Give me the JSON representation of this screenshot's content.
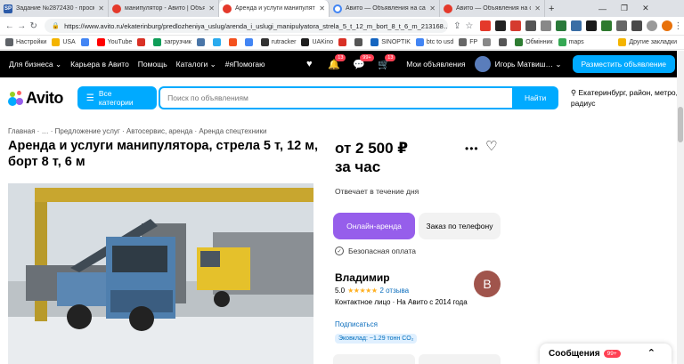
{
  "browser": {
    "tabs": [
      {
        "label": "Задание №2872430 - просмо",
        "favicon": "SP",
        "color": "#2b5aa8",
        "active": false
      },
      {
        "label": "манипулятор - Авито | Объявле",
        "favicon": "",
        "color": "#e4392b",
        "active": false
      },
      {
        "label": "Аренда и услуги манипулятор",
        "favicon": "",
        "color": "#e4392b",
        "active": true
      },
      {
        "label": "Авито — Объявления на сайт",
        "favicon": "",
        "color": "#4285f4",
        "active": false
      },
      {
        "label": "Авито — Объявления на сайт",
        "favicon": "",
        "color": "#e4392b",
        "active": false
      }
    ],
    "url": "https://www.avito.ru/ekaterinburg/predlozheniya_uslug/arenda_i_uslugi_manipulyatora_strela_5_t_12_m_bort_8_t_6_m_213168…",
    "bookmarks": [
      "Настройки",
      "USA",
      "",
      "YouTube",
      "",
      "загрузчик",
      "",
      "",
      "",
      "",
      "rutracker",
      "UAKino",
      "",
      "",
      "SINOPTIK",
      "btc to usd",
      "FP",
      "",
      "",
      "Обмінник",
      "maps"
    ],
    "other_bookmarks": "Другие закладки"
  },
  "topnav": {
    "items": [
      "Для бизнеса",
      "Карьера в Авито",
      "Помощь",
      "Каталоги",
      "#яПомогаю"
    ],
    "badges": {
      "notifications": "13",
      "messages": "99+",
      "cart": "13"
    },
    "my_ads": "Мои объявления",
    "user": "Игорь Матвиш…",
    "place_ad": "Разместить объявление"
  },
  "search": {
    "logo": "Avito",
    "categories_button": "Все категории",
    "placeholder": "Поиск по объявлениям",
    "find_button": "Найти",
    "location": "Екатеринбург, район, метро, радиус"
  },
  "listing": {
    "breadcrumb": [
      "Главная",
      "…",
      "Предложение услуг",
      "Автосервис, аренда",
      "Аренда спецтехники"
    ],
    "title": "Аренда и услуги манипулятора, стрела 5 т, 12 м, борт 8 т, 6 м",
    "price_line1": "от 2 500 ₽",
    "price_line2": "за час",
    "replies": "Отвечает в течение дня",
    "rent_button": "Онлайн-аренда",
    "phone_button": "Заказ по телефону",
    "safe_payment": "Безопасная оплата"
  },
  "seller": {
    "name": "Владимир",
    "rating": "5.0",
    "stars": "★★★★★",
    "reviews": "2 отзыва",
    "contact": "Контактное лицо · На Авито с 2014 года",
    "subscribe": "Подписаться",
    "eco": "Эковклад: ~1.29 тонн CO₂",
    "avatar_letter": "В"
  },
  "widgets": {
    "messages_label": "Сообщения",
    "messages_badge": "99+"
  }
}
